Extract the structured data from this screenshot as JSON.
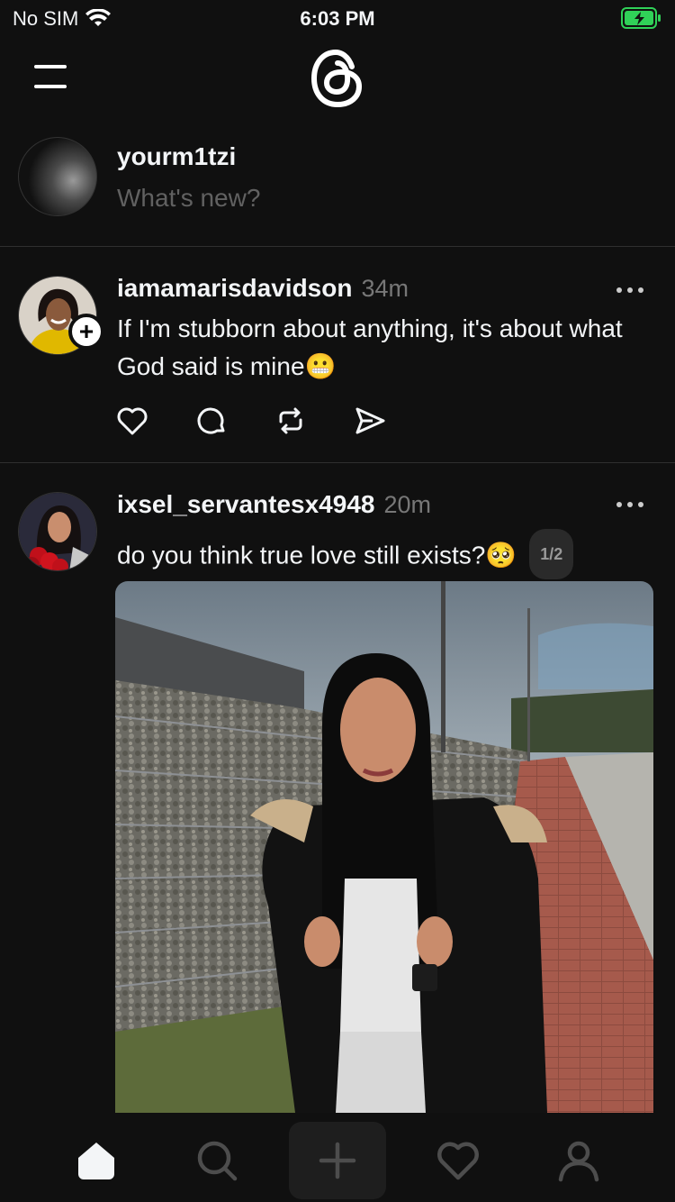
{
  "status": {
    "carrier": "No SIM",
    "time": "6:03 PM",
    "battery": "charging"
  },
  "composer": {
    "username": "yourm1tzi",
    "placeholder": "What's new?"
  },
  "posts": [
    {
      "author": "iamamarisdavidson",
      "time": "34m",
      "text": "If I'm stubborn about anything, it's about what God said is mine",
      "emoji": "😬",
      "follow_badge": "+"
    },
    {
      "author": "ixsel_servantesx4948",
      "time": "20m",
      "text": "do you think true love still exists?",
      "emoji": "🥺",
      "page_indicator": "1/2"
    }
  ],
  "tabs": [
    "home-icon",
    "search-icon",
    "create-icon",
    "activity-icon",
    "profile-icon"
  ],
  "colors": {
    "background": "#101010",
    "text": "#f3f5f7",
    "muted": "#616161",
    "divider": "#2f2f2f",
    "battery": "#30d158"
  }
}
